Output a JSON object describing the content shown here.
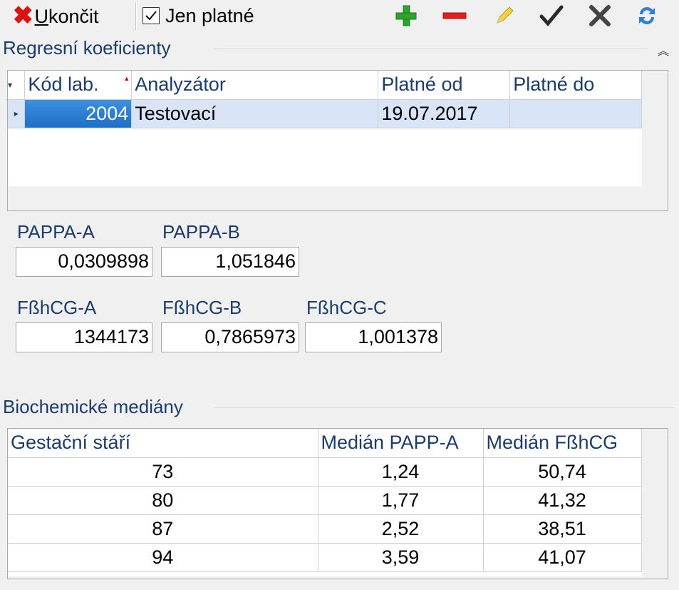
{
  "toolbar": {
    "exit_label_accel": "U",
    "exit_label_rest": "končit",
    "only_valid_label": "Jen platné",
    "only_valid_checked": true,
    "icons": [
      "add-icon",
      "remove-icon",
      "edit-icon",
      "confirm-icon",
      "cancel-icon",
      "refresh-icon"
    ]
  },
  "regression": {
    "title": "Regresní koeficienty",
    "columns": [
      "Kód lab.",
      "Analyzátor",
      "Platné od",
      "Platné do"
    ],
    "rows": [
      {
        "kod": "2004",
        "analyzator": "Testovací",
        "platne_od": "19.07.2017",
        "platne_do": ""
      }
    ],
    "fields": {
      "pappa_a_label": "PAPPA-A",
      "pappa_a_value": "0,0309898",
      "pappa_b_label": "PAPPA-B",
      "pappa_b_value": "1,051846",
      "fbhcg_a_label": "FßhCG-A",
      "fbhcg_a_value": "1344173",
      "fbhcg_b_label": "FßhCG-B",
      "fbhcg_b_value": "0,7865973",
      "fbhcg_c_label": "FßhCG-C",
      "fbhcg_c_value": "1,001378"
    }
  },
  "medians": {
    "title": "Biochemické mediány",
    "columns": [
      "Gestační stáří",
      "Medián PAPP-A",
      "Medián FßhCG"
    ],
    "rows": [
      [
        "73",
        "1,24",
        "50,74"
      ],
      [
        "80",
        "1,77",
        "41,32"
      ],
      [
        "87",
        "2,52",
        "38,51"
      ],
      [
        "94",
        "3,59",
        "41,07"
      ]
    ]
  }
}
